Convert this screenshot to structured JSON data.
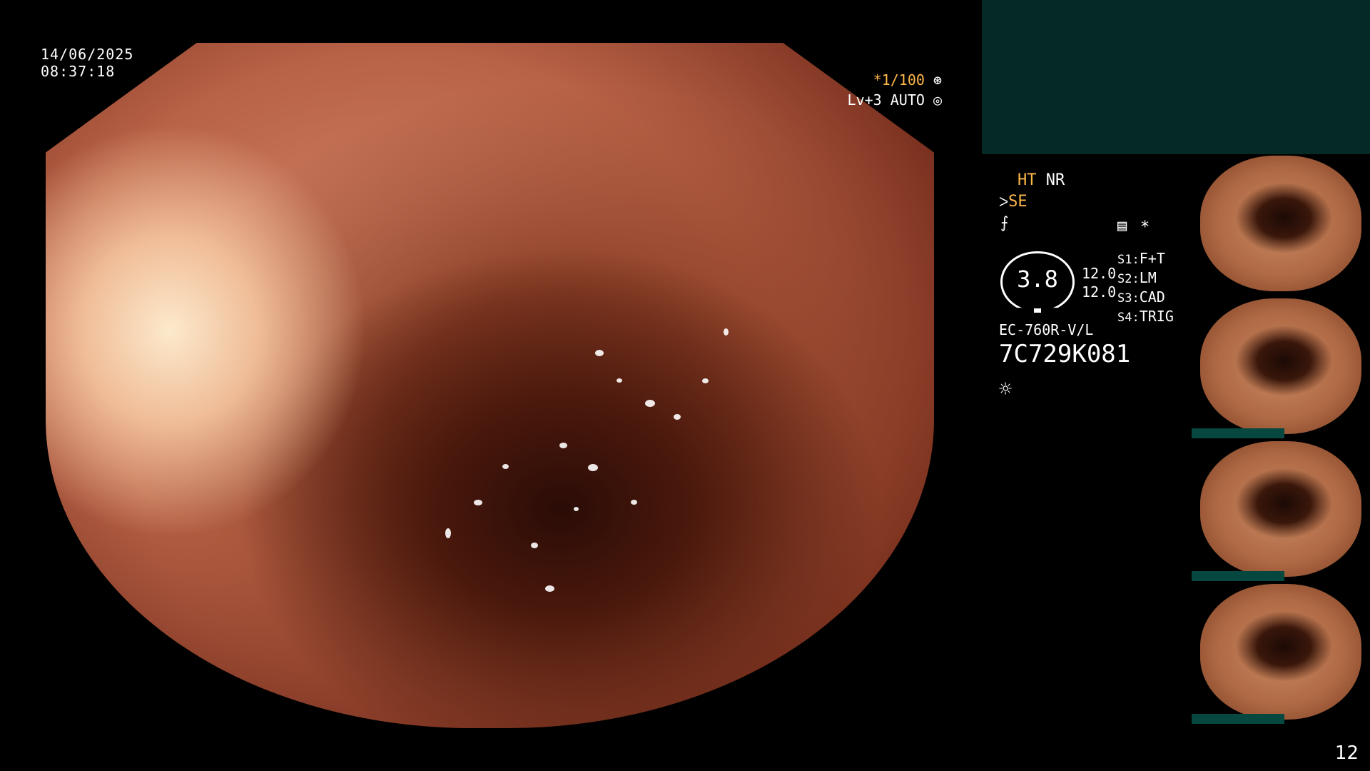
{
  "overlay": {
    "date": "14/06/2025",
    "time": "08:37:18",
    "shutter": "*1/100",
    "shutter_icon": "aperture-icon",
    "level": "Lv+3 AUTO",
    "level_icon": "iris-icon"
  },
  "info_panel": {
    "ht": "HT",
    "nr": "NR",
    "se": "SE",
    "se_prefix_icon": "hand-icon",
    "f_icon": "f-curve-icon",
    "menu_icon": "menu-icon",
    "star": "*",
    "gauge_value": "3.8",
    "value_1": "12.0",
    "value_2": "12.0",
    "s1": "S1:",
    "s1_value": "F+T",
    "s2": "S2:",
    "s2_value": "LM",
    "s3": "S3:",
    "s3_value": "CAD",
    "s4": "S4:",
    "s4_value": "TRIG",
    "scope_model": "EC-760R-V/L",
    "serial": "7C729K081",
    "light_icon": "sun-icon"
  },
  "thumbnails": [
    {
      "label": "thumbnail-1"
    },
    {
      "label": "thumbnail-2"
    },
    {
      "label": "thumbnail-3"
    },
    {
      "label": "thumbnail-4"
    }
  ],
  "page_number": "12",
  "colors": {
    "accent_orange": "#ffb84a",
    "panel_teal": "#052a26"
  }
}
